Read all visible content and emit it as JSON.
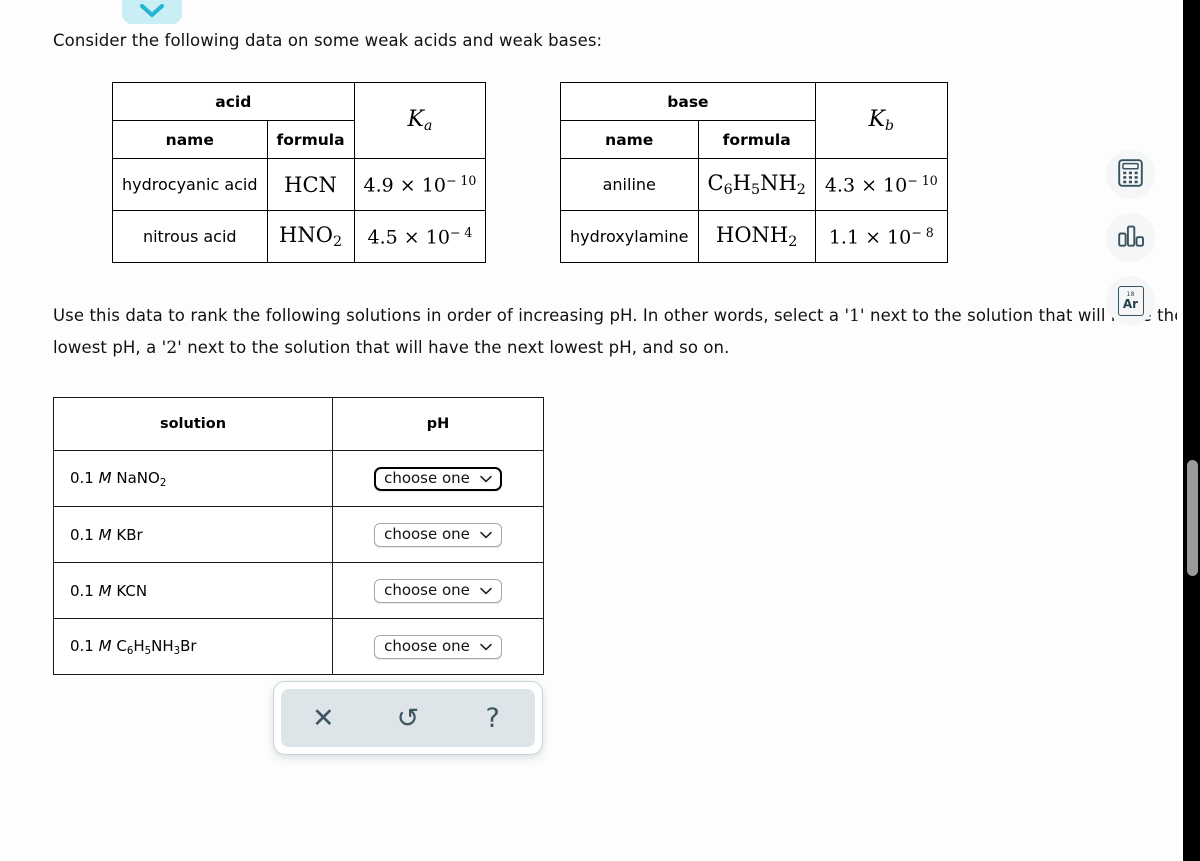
{
  "top_control": {
    "icon": "chevron-down-icon"
  },
  "prompt": "Consider the following data on some weak acids and weak bases:",
  "acid_table": {
    "group_header": "acid",
    "columns": [
      "name",
      "formula"
    ],
    "k_header": {
      "symbol": "K",
      "subscript": "a"
    },
    "rows": [
      {
        "name": "hydrocyanic acid",
        "formula_parts": [
          {
            "t": "HCN",
            "s": ""
          }
        ],
        "k_mantissa": "4.9 × 10",
        "k_exponent": "− 10"
      },
      {
        "name": "nitrous acid",
        "formula_parts": [
          {
            "t": "HNO",
            "s": "2"
          }
        ],
        "k_mantissa": "4.5 × 10",
        "k_exponent": "− 4"
      }
    ]
  },
  "base_table": {
    "group_header": "base",
    "columns": [
      "name",
      "formula"
    ],
    "k_header": {
      "symbol": "K",
      "subscript": "b"
    },
    "rows": [
      {
        "name": "aniline",
        "formula_parts": [
          {
            "t": "C",
            "s": "6"
          },
          {
            "t": "H",
            "s": "5"
          },
          {
            "t": "NH",
            "s": "2"
          }
        ],
        "k_mantissa": "4.3 × 10",
        "k_exponent": "− 10"
      },
      {
        "name": "hydroxylamine",
        "formula_parts": [
          {
            "t": "HONH",
            "s": "2"
          }
        ],
        "k_mantissa": "1.1 × 10",
        "k_exponent": "− 8"
      }
    ]
  },
  "instructions": {
    "line1_a": "Use this data to rank the following solutions in order of increasing pH. In other words, select a '",
    "q1": "1",
    "line1_b": "' next to the solution that will have the lowest pH, a '",
    "q2": "2",
    "line1_c": "' next to the solution that will have the next lowest pH, and so on."
  },
  "solutions_table": {
    "headers": [
      "solution",
      "pH"
    ],
    "rows": [
      {
        "concentration": "0.1",
        "unit": "M",
        "formula_parts": [
          {
            "t": "NaNO",
            "s": "2"
          }
        ],
        "select_value": "choose one",
        "focused": true
      },
      {
        "concentration": "0.1",
        "unit": "M",
        "formula_parts": [
          {
            "t": "KBr",
            "s": ""
          }
        ],
        "select_value": "choose one",
        "focused": false
      },
      {
        "concentration": "0.1",
        "unit": "M",
        "formula_parts": [
          {
            "t": "KCN",
            "s": ""
          }
        ],
        "select_value": "choose one",
        "focused": false
      },
      {
        "concentration": "0.1",
        "unit": "M",
        "formula_parts": [
          {
            "t": "C",
            "s": "6"
          },
          {
            "t": "H",
            "s": "5"
          },
          {
            "t": "NH",
            "s": "3"
          },
          {
            "t": "Br",
            "s": ""
          }
        ],
        "select_value": "choose one",
        "focused": false
      }
    ]
  },
  "toolbar": {
    "buttons": [
      {
        "name": "clear-button",
        "icon": "close-x-icon",
        "glyph": "✕"
      },
      {
        "name": "undo-button",
        "icon": "undo-arrow-icon",
        "glyph": "↺"
      },
      {
        "name": "help-button",
        "icon": "question-mark-icon",
        "glyph": "?"
      }
    ]
  },
  "side_tools": [
    {
      "name": "calculator-tool",
      "icon": "calculator-icon"
    },
    {
      "name": "chart-tool",
      "icon": "bar-chart-icon"
    },
    {
      "name": "periodic-table-tool",
      "icon": "periodic-table-icon",
      "element_number": "18",
      "element_symbol": "Ar"
    }
  ],
  "colors": {
    "chevron_pill_bg": "#c9eef3",
    "chevron_stroke": "#26b6d4",
    "toolbar_inner_bg": "#dde5e8",
    "tool_icon": "#36535f",
    "scrollbar_thumb": "#9a9a9a"
  }
}
